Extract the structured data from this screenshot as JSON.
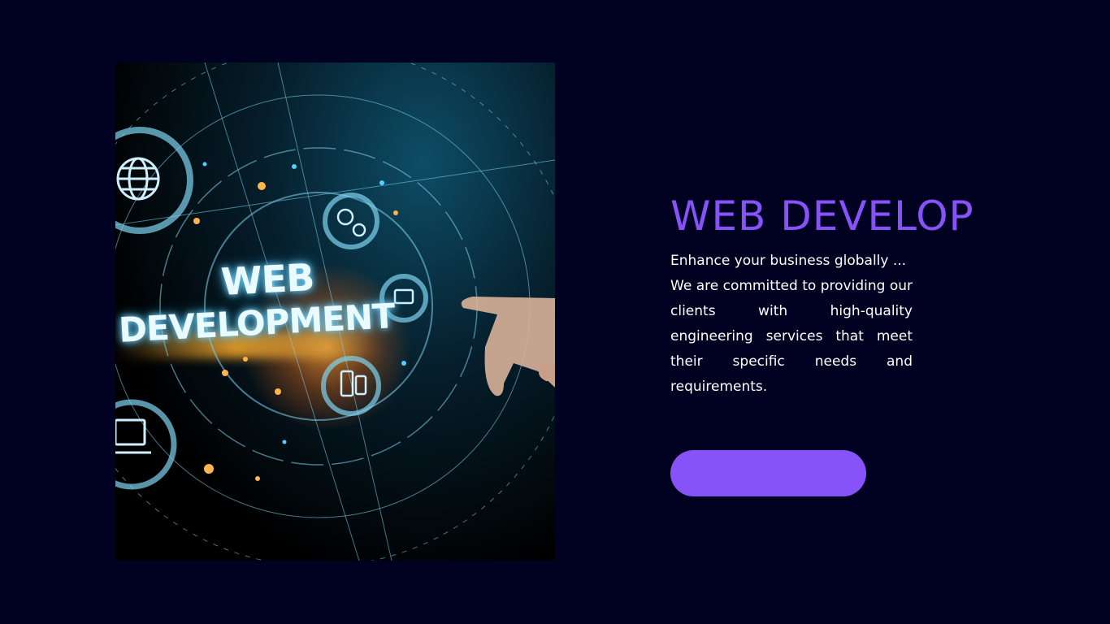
{
  "hero": {
    "image_text_line1": "WEB",
    "image_text_line2": "DEVELOPMENT"
  },
  "content": {
    "title": "WEB DEVELOP",
    "tagline": "Enhance your business globally ...",
    "description": "We are committed to providing our clients with high-quality engineering services that meet their specific needs and requirements.",
    "cta_label": ""
  },
  "colors": {
    "background": "#010122",
    "accent": "#8752f8",
    "text": "#ffffff"
  },
  "icons": [
    "globe-icon",
    "gears-icon",
    "refresh-icon",
    "code-laptop-icon",
    "mobile-icon"
  ]
}
